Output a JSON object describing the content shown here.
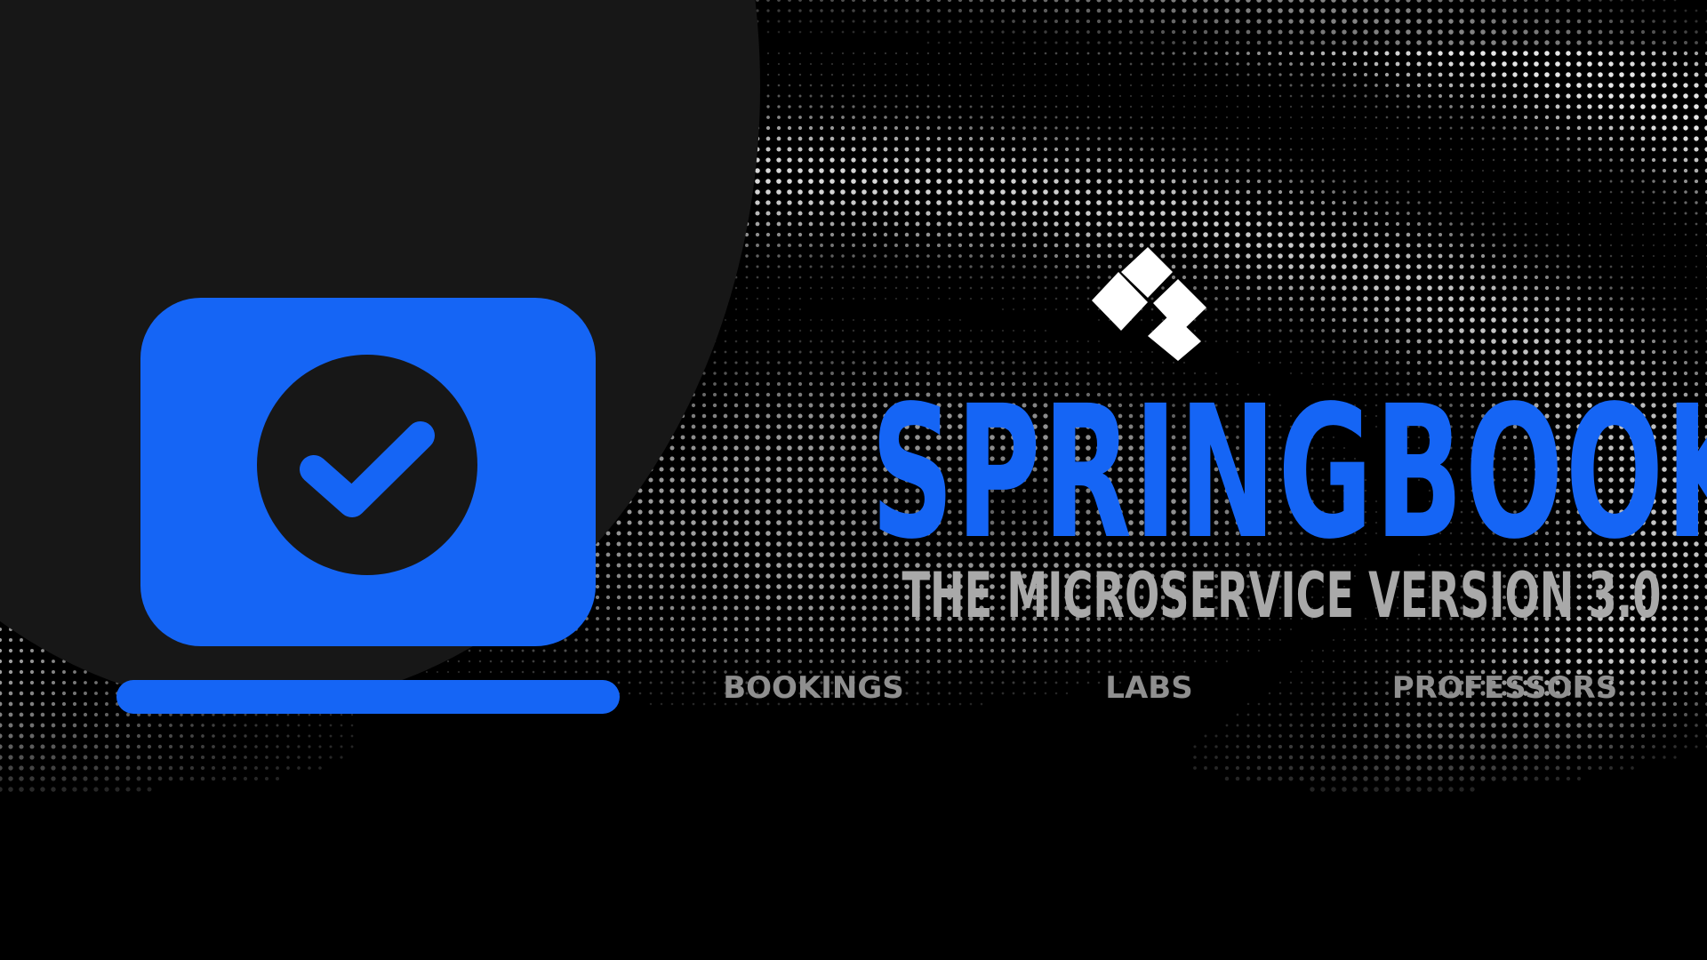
{
  "app": {
    "title": "SPRINGBOOK",
    "subtitle": "THE MICROSERVICE VERSION 3.0"
  },
  "nav": {
    "items": [
      {
        "label": "BOOKINGS"
      },
      {
        "label": "LABS"
      },
      {
        "label": "PROFESSORS"
      }
    ]
  },
  "icons": {
    "hero": "laptop-check-icon",
    "logo": "cross-arrow-logo"
  },
  "colors": {
    "background": "#000000",
    "circle": "#171717",
    "accent": "#1565f5",
    "subtitle": "#a9a9a9",
    "nav_text": "#8f8f8f",
    "logo": "#ffffff"
  }
}
